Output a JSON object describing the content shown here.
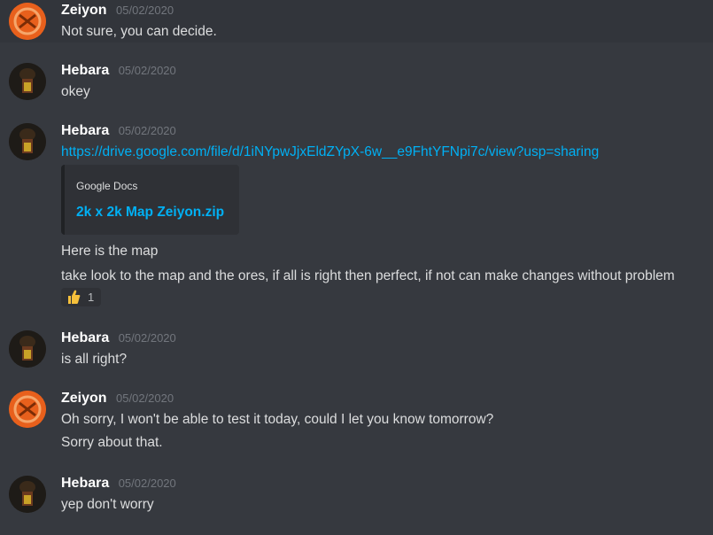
{
  "messages": [
    {
      "username": "Zeiyon",
      "timestamp": "05/02/2020",
      "lines": [
        "Not sure, you can decide."
      ]
    },
    {
      "username": "Hebara",
      "timestamp": "05/02/2020",
      "lines": [
        "okey"
      ]
    },
    {
      "username": "Hebara",
      "timestamp": "05/02/2020",
      "link": "https://drive.google.com/file/d/1iNYpwJjxEldZYpX-6w__e9FhtYFNpi7c/view?usp=sharing",
      "embed": {
        "provider": "Google Docs",
        "title": "2k x 2k Map Zeiyon.zip"
      },
      "lines": [
        "Here is the map",
        "take look to the map and the ores, if all is right then perfect, if not can make changes without problem"
      ],
      "reaction": {
        "emoji": "thumbs-up-icon",
        "count": "1"
      }
    },
    {
      "username": "Hebara",
      "timestamp": "05/02/2020",
      "lines": [
        "is all right?"
      ]
    },
    {
      "username": "Zeiyon",
      "timestamp": "05/02/2020",
      "lines": [
        "Oh sorry, I won't be able to test it today, could I let you know tomorrow?",
        "Sorry about that."
      ]
    },
    {
      "username": "Hebara",
      "timestamp": "05/02/2020",
      "lines": [
        "yep don't worry"
      ]
    }
  ],
  "colors": {
    "background": "#36393f",
    "link": "#00b0f4",
    "username": "#ffffff",
    "zeiyon_avatar": "#e8601c"
  }
}
